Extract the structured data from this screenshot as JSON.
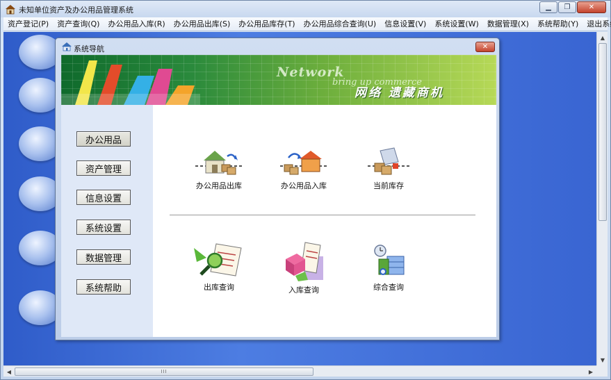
{
  "window": {
    "title": "未知单位资产及办公用品管理系统",
    "icon": "house-icon",
    "controls": [
      "minimize",
      "maximize",
      "close"
    ]
  },
  "menu": [
    {
      "label": "资产登记(P)"
    },
    {
      "label": "资产查询(Q)"
    },
    {
      "label": "办公用品入库(R)"
    },
    {
      "label": "办公用品出库(S)"
    },
    {
      "label": "办公用品库存(T)"
    },
    {
      "label": "办公用品综合查询(U)"
    },
    {
      "label": "信息设置(V)"
    },
    {
      "label": "系统设置(W)"
    },
    {
      "label": "数据管理(X)"
    },
    {
      "label": "系统帮助(Y)"
    },
    {
      "label": "退出系统(Z)"
    }
  ],
  "nav_window": {
    "title": "系统导航",
    "close_glyph": "✕",
    "banner": {
      "english": "Network",
      "english_sub": "bring up commerce",
      "chinese": "网络 遗藏商机"
    },
    "sidebar": [
      {
        "label": "办公用品",
        "active": true
      },
      {
        "label": "资产管理",
        "active": false
      },
      {
        "label": "信息设置",
        "active": false
      },
      {
        "label": "系统设置",
        "active": false
      },
      {
        "label": "数据管理",
        "active": false
      },
      {
        "label": "系统帮助",
        "active": false
      }
    ],
    "tiles_top": [
      {
        "label": "办公用品出库",
        "icon": "warehouse-outbound-icon"
      },
      {
        "label": "办公用品入库",
        "icon": "warehouse-inbound-icon"
      },
      {
        "label": "当前库存",
        "icon": "current-stock-icon"
      }
    ],
    "tiles_bottom": [
      {
        "label": "出库查询",
        "icon": "outbound-query-icon"
      },
      {
        "label": "入库查询",
        "icon": "inbound-query-icon"
      },
      {
        "label": "综合查询",
        "icon": "comprehensive-query-icon"
      }
    ]
  },
  "scrollbar": {
    "thumb_grip": "III"
  }
}
